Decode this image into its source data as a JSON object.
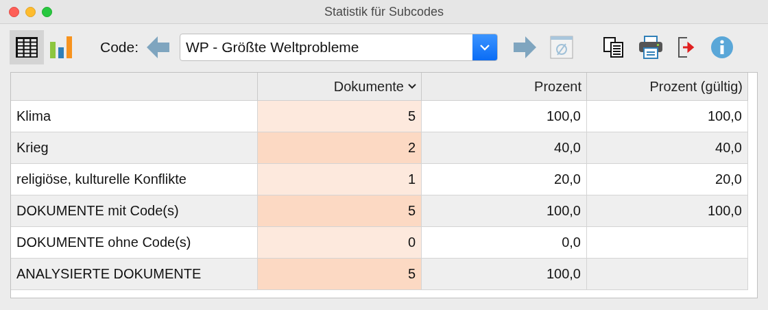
{
  "window": {
    "title": "Statistik für Subcodes"
  },
  "toolbar": {
    "views": [
      {
        "kind": "table",
        "selected": true
      },
      {
        "kind": "chart",
        "selected": false
      }
    ],
    "code_label": "Code:",
    "code_value": "WP - Größte Weltprobleme"
  },
  "table": {
    "columns": [
      {
        "sorted": false
      },
      {
        "label": "Dokumente",
        "sorted": true
      },
      {
        "label": "Prozent",
        "sorted": false
      },
      {
        "label": "Prozent (gültig)",
        "sorted": false
      }
    ],
    "rows": [
      [
        "Klima",
        "5",
        "100,0",
        "100,0"
      ],
      [
        "Krieg",
        "2",
        "40,0",
        "40,0"
      ],
      [
        "religiöse, kulturelle Konflikte",
        "1",
        "20,0",
        "20,0"
      ],
      [
        "DOKUMENTE mit Code(s)",
        "5",
        "100,0",
        "100,0"
      ],
      [
        "DOKUMENTE ohne Code(s)",
        "0",
        "0,0",
        ""
      ],
      [
        "ANALYSIERTE DOKUMENTE",
        "5",
        "100,0",
        ""
      ]
    ]
  }
}
